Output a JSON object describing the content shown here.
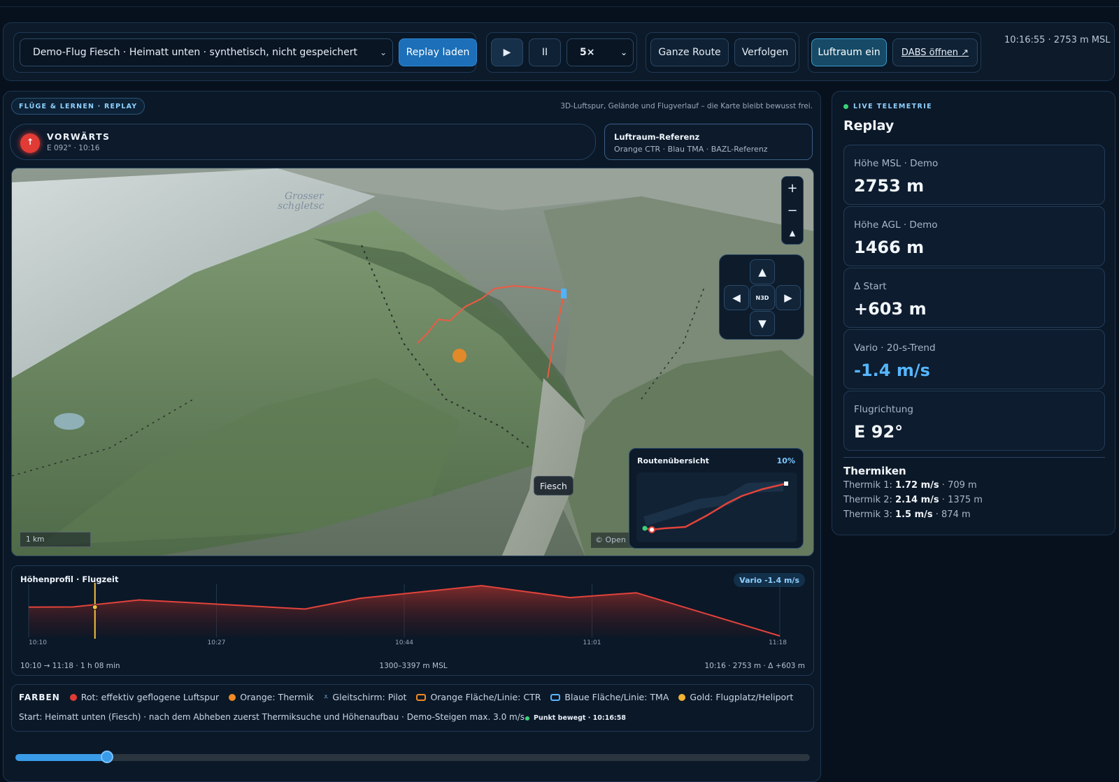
{
  "toolbar": {
    "flight_select": "Demo-Flug Fiesch · Heimatt unten · synthetisch, nicht gespeichert",
    "load_replay": "Replay laden",
    "play_icon": "▶",
    "pause_icon": "II",
    "speed": "5×",
    "whole_route": "Ganze Route",
    "follow": "Verfolgen",
    "airspace_on": "Luftraum ein",
    "open_dabs": "DABS öffnen ↗",
    "clock": "10:16:55 · 2753 m MSL"
  },
  "header": {
    "section_pill": "FLÜGE & LERNEN · REPLAY",
    "subtitle": "3D-Luftspur, Gelände und Flugverlauf – die Karte bleibt bewusst frei."
  },
  "direction": {
    "title": "VORWÄRTS",
    "sub": "E 092° · 10:16"
  },
  "airspace_ref": {
    "title": "Luftraum-Referenz",
    "sub": "Orange CTR · Blau TMA · BAZL-Referenz"
  },
  "map": {
    "zoom_in": "+",
    "zoom_out": "−",
    "compass": "▲",
    "nav_up": "▲",
    "nav_down": "▼",
    "nav_left": "◀",
    "nav_right": "▶",
    "nav_center_top": "N",
    "nav_center_bottom": "3D",
    "scale": "1 km",
    "copyright": "© Open",
    "place_label": "Fiesch",
    "overview_title": "Routenübersicht",
    "overview_pct": "10%"
  },
  "profile": {
    "title": "Höhenprofil · Flugzeit",
    "vario_badge": "Vario -1.4 m/s",
    "ticks": [
      "10:10",
      "10:27",
      "10:44",
      "11:01",
      "11:18"
    ],
    "foot_left": "10:10 → 11:18 · 1 h 08 min",
    "foot_center": "1300–3397 m MSL",
    "foot_right": "10:16 · 2753 m · Δ +603 m"
  },
  "chart_data": {
    "type": "area",
    "title": "Höhenprofil · Flugzeit",
    "x": [
      "10:10",
      "10:14",
      "10:20",
      "10:22",
      "10:35",
      "10:40",
      "10:51",
      "10:59",
      "11:05",
      "11:18"
    ],
    "y": [
      2500,
      2510,
      2800,
      2753,
      2420,
      2870,
      3397,
      2900,
      3100,
      1300
    ],
    "ylim": [
      1300,
      3397
    ],
    "cursor_time": "10:16",
    "color": "#e2433b"
  },
  "legend": {
    "title": "FARBEN",
    "items": [
      {
        "label": "Rot: effektiv geflogene Luftspur",
        "color": "#e23b35",
        "kind": "dot"
      },
      {
        "label": "Orange: Thermik",
        "color": "#f08a24",
        "kind": "dot"
      },
      {
        "label": "Gleitschirm: Pilot",
        "color": "#7cc7ff",
        "kind": "glider"
      },
      {
        "label": "Orange Fläche/Linie: CTR",
        "color": "#f08a24",
        "kind": "box"
      },
      {
        "label": "Blaue Fläche/Linie: TMA",
        "color": "#55b6ff",
        "kind": "box"
      },
      {
        "label": "Gold: Flugplatz/Heliport",
        "color": "#f2b233",
        "kind": "dot"
      }
    ],
    "start_text": "Start: Heimatt unten (Fiesch) · nach dem Abheben zuerst Thermiksuche und Höhenaufbau · Demo-Steigen max. 3.0 m/s.",
    "moved": "Punkt bewegt · 10:16:58"
  },
  "timeline": {
    "progress": 0.115
  },
  "sidebar": {
    "live_label": "LIVE TELEMETRIE",
    "title": "Replay",
    "stats": [
      {
        "label": "Höhe MSL · Demo",
        "value": "2753 m",
        "accent": false
      },
      {
        "label": "Höhe AGL · Demo",
        "value": "1466 m",
        "accent": false
      },
      {
        "label": "Δ Start",
        "value": "+603 m",
        "accent": false
      },
      {
        "label": "Vario · 20-s-Trend",
        "value": "-1.4 m/s",
        "accent": true
      },
      {
        "label": "Flugrichtung",
        "value": "E 92°",
        "accent": false
      }
    ],
    "thermals_title": "Thermiken",
    "thermals": [
      {
        "name": "Thermik 1:",
        "rate": "1.72 m/s",
        "alt": " · 709 m"
      },
      {
        "name": "Thermik 2:",
        "rate": "2.14 m/s",
        "alt": " · 1375 m"
      },
      {
        "name": "Thermik 3:",
        "rate": "1.5 m/s",
        "alt": " · 874 m"
      }
    ]
  }
}
